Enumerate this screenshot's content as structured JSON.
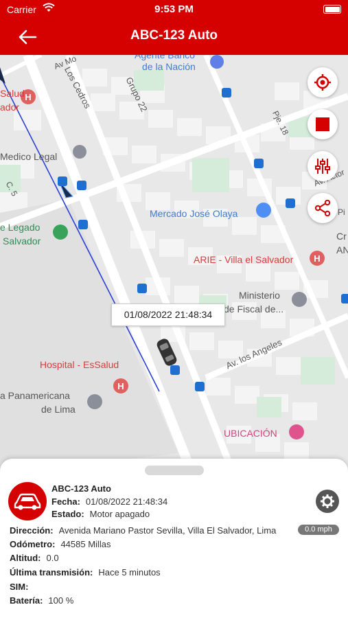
{
  "status_bar": {
    "carrier": "Carrier",
    "time": "9:53 PM"
  },
  "header": {
    "title": "ABC-123 Auto"
  },
  "map": {
    "labels": {
      "banco": "Agente Banco",
      "nacion": "de la Nación",
      "av_mo": "Av Mo",
      "los_cedros": "Los Cedros",
      "grupo22": "Grupo 22",
      "salud": "Salud",
      "ador": "ador",
      "medico_legal": "Medico Legal",
      "c5": "C. 5",
      "pje18": "Pje. 18",
      "av_actor": "Av. Actor",
      "pi": "Pi",
      "mercado": "Mercado José Olaya",
      "legado": "e Legado",
      "salvador": "Salvador",
      "cr": "Cr",
      "an": "AN",
      "arie": "ARIE - Villa el Salvador",
      "ministerio": "Ministerio",
      "fiscal": "de Fiscal de...",
      "av_angeles": "Av. los Angeles",
      "hospital": "Hospital - EsSalud",
      "panamericana": "a Panamericana",
      "de_lima": "de Lima",
      "ubicacion": "UBICACIÓN"
    },
    "tooltip": "01/08/2022 21:48:34",
    "colors": {
      "route": "#2b3fd6",
      "brand": "#d50000"
    }
  },
  "panel": {
    "vehicle": "ABC-123 Auto",
    "fecha_label": "Fecha:",
    "fecha": "01/08/2022 21:48:34",
    "estado_label": "Estado:",
    "estado": "Motor apagado",
    "direccion_label": "Dirección:",
    "direccion": "Avenida Mariano Pastor Sevilla, Villa El Salvador, Lima",
    "odometro_label": "Odómetro:",
    "odometro": "44585 Millas",
    "altitud_label": "Altitud:",
    "altitud": "0.0",
    "transmision_label": "Última transmisión:",
    "transmision": "Hace 5 minutos",
    "sim_label": "SIM:",
    "sim": "",
    "bateria_label": "Batería:",
    "bateria": "100 %",
    "speed": "0.0 mph"
  }
}
